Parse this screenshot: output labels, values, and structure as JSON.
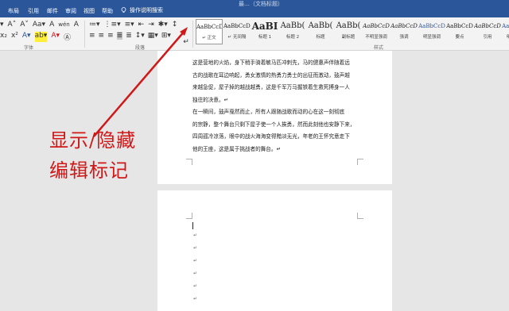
{
  "menubar": {
    "title": "最…（文档标题）",
    "items": [
      "布局",
      "引用",
      "邮件",
      "审阅",
      "视图",
      "帮助"
    ],
    "tell_me": "操作说明搜索"
  },
  "ribbon": {
    "font_row": [
      "▾",
      "A˄",
      "A˅",
      "Aa▾",
      "A",
      "wén",
      "A"
    ],
    "font_row2": [
      "x₂",
      "x²",
      "A▾",
      "ab▾",
      "A▾",
      "Ⓐ"
    ],
    "para_row": [
      "≔▾",
      "⋮≡▾",
      "≡▾",
      "⇤",
      "⇥",
      "✱▾",
      "↕"
    ],
    "para_row2": [
      "≡",
      "≡",
      "≡",
      "≣",
      "≣",
      "↕▾",
      "▦▾",
      "⊞▾"
    ],
    "font_group_label": "字体",
    "para_group_label": "段落",
    "styles_group_label": "样式",
    "show_marks_symbol": "↵",
    "styles": [
      {
        "sample": "AaBbCcDc",
        "name": "↵ 正文",
        "kind": "normal"
      },
      {
        "sample": "AaBbCcDc",
        "name": "↵ 无间隔",
        "kind": "normal"
      },
      {
        "sample": "AaBI",
        "name": "标题 1",
        "kind": "big"
      },
      {
        "sample": "AaBb(",
        "name": "标题 2",
        "kind": "mid"
      },
      {
        "sample": "AaBb(",
        "name": "标题",
        "kind": "mid"
      },
      {
        "sample": "AaBb(",
        "name": "副标题",
        "kind": "mid"
      },
      {
        "sample": "AaBbCcD",
        "name": "不明显强调",
        "kind": "italic"
      },
      {
        "sample": "AaBbCcD",
        "name": "强调",
        "kind": "italic"
      },
      {
        "sample": "AaBbCcD",
        "name": "明显强调",
        "kind": "blue"
      },
      {
        "sample": "AaBbCcD",
        "name": "要点",
        "kind": "normal"
      },
      {
        "sample": "AaBbCcD",
        "name": "引用",
        "kind": "italic"
      },
      {
        "sample": "AaBbCcD",
        "name": "明显引用",
        "kind": "blue"
      }
    ]
  },
  "document": {
    "page1_lines": [
      "这是营地的火焰，身下稍手骑着敏马匹冲刺先，马的健惠声伴随着远",
      "古的战歌在耳边响起，勇女激情的热勇力勇士的出征而激动，鼓声越",
      "来越急促，屋子掉的越战越勇，这是千军万马握铁着生救死搏身一人",
      "独往的决意。↵",
      "在一瞬间，鼓声戛然而止，所有人跟随战歌而动的心在这一刻彻底",
      "的宗静，整个舞台只剩下屋子使一个人挨勇，然而此刻他也安静下来，",
      "四周孤冷凉落，眼中的战火海海变得黯淡无光，年老的王怀究意走下",
      "他的王座，这是属于挑战者的舞台。↵"
    ],
    "page2_marks": [
      "↵",
      "↵",
      "↵",
      "↵",
      "↵",
      "↵"
    ]
  },
  "annotation": {
    "line1": "显示/隐藏",
    "line2": "编辑标记",
    "color": "#d01818"
  }
}
